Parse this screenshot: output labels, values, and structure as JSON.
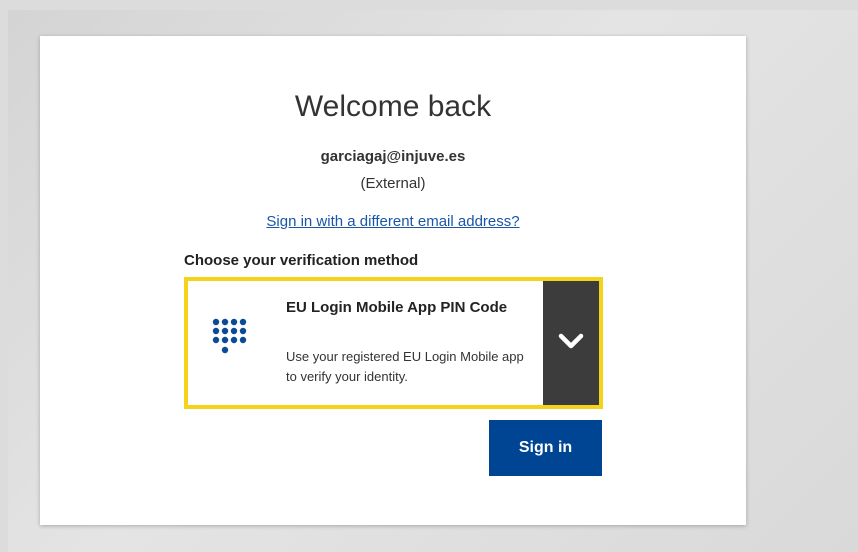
{
  "page": {
    "title": "Welcome back",
    "email": "garciagaj@injuve.es",
    "account_type": "(External)",
    "different_email_link": "Sign in with a different email address?"
  },
  "verification": {
    "label": "Choose your verification method",
    "selected_method": {
      "icon": "keypad-icon",
      "title": "EU Login Mobile App PIN Code",
      "description": "Use your registered EU Login Mobile app to verify your identity."
    },
    "dropdown_icon": "chevron-down-icon"
  },
  "actions": {
    "sign_in_label": "Sign in"
  },
  "colors": {
    "accent_border": "#f6d31b",
    "primary_button": "#004494",
    "link": "#1a56a8",
    "chevron_bg": "#3c3c3c",
    "icon_blue": "#0b4a94"
  }
}
